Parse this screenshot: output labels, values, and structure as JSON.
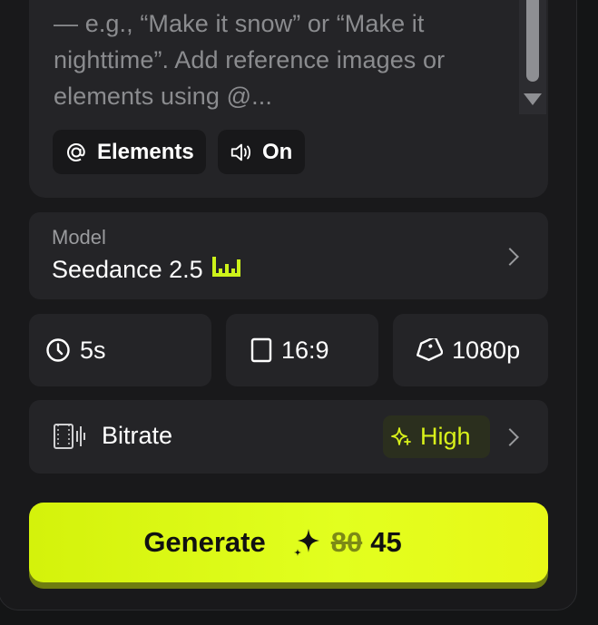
{
  "prompt": {
    "text": "— e.g., “Make it snow” or “Make it nighttime”. Add reference images or elements using @..."
  },
  "chips": {
    "elements_label": "Elements",
    "sound_label": "On"
  },
  "model": {
    "label": "Model",
    "name": "Seedance 2.5"
  },
  "options": {
    "duration": "5s",
    "aspect_ratio": "16:9",
    "resolution": "1080p"
  },
  "bitrate": {
    "label": "Bitrate",
    "value": "High"
  },
  "generate": {
    "label": "Generate",
    "old_cost": "80",
    "cost": "45"
  },
  "colors": {
    "accent": "#e2ff1f",
    "panel": "#19191b",
    "card": "#242427"
  },
  "icons": [
    "at-icon",
    "speaker-icon",
    "bars-icon",
    "clock-icon",
    "aspect-ratio-icon",
    "diamond-icon",
    "film-icon",
    "sparkle-icon",
    "chevron-right-icon",
    "sparkle-4-icon"
  ]
}
